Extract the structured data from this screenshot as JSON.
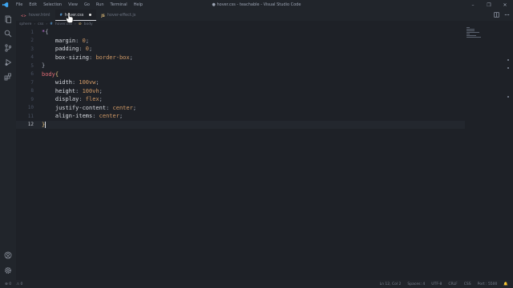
{
  "window": {
    "title": "● hover.css - teachable - Visual Studio Code",
    "menu": [
      "File",
      "Edit",
      "Selection",
      "View",
      "Go",
      "Run",
      "Terminal",
      "Help"
    ],
    "controls": [
      "–",
      "❐",
      "✕"
    ]
  },
  "tabs": [
    {
      "icon": "<>",
      "label": "hover.html",
      "active": false
    },
    {
      "icon": "#",
      "label": "hover.css",
      "active": true,
      "modified": true
    },
    {
      "icon": "JS",
      "label": "hover-effect.js",
      "active": false
    }
  ],
  "breadcrumb": [
    "sphere",
    "css",
    "hover.css",
    "body"
  ],
  "editor": {
    "current_line": 12,
    "lines": [
      {
        "n": "1",
        "parts": [
          {
            "t": "*",
            "c": "sel"
          },
          {
            "t": "{",
            "c": "punc"
          }
        ]
      },
      {
        "n": "2",
        "parts": [
          {
            "t": "    margin",
            "c": "prop"
          },
          {
            "t": ": ",
            "c": "punc"
          },
          {
            "t": "0",
            "c": "val"
          },
          {
            "t": ";",
            "c": "punc"
          }
        ]
      },
      {
        "n": "3",
        "parts": [
          {
            "t": "    padding",
            "c": "prop"
          },
          {
            "t": ": ",
            "c": "punc"
          },
          {
            "t": "0",
            "c": "val"
          },
          {
            "t": ";",
            "c": "punc"
          }
        ]
      },
      {
        "n": "4",
        "parts": [
          {
            "t": "    box-sizing",
            "c": "prop"
          },
          {
            "t": ": ",
            "c": "punc"
          },
          {
            "t": "border-box",
            "c": "val"
          },
          {
            "t": ";",
            "c": "punc"
          }
        ]
      },
      {
        "n": "5",
        "parts": [
          {
            "t": "}",
            "c": "punc"
          }
        ]
      },
      {
        "n": "6",
        "parts": [
          {
            "t": "body",
            "c": "tag"
          },
          {
            "t": "{",
            "c": "kw"
          }
        ]
      },
      {
        "n": "7",
        "parts": [
          {
            "t": "    width",
            "c": "prop"
          },
          {
            "t": ": ",
            "c": "punc"
          },
          {
            "t": "100vw",
            "c": "val"
          },
          {
            "t": ";",
            "c": "punc"
          }
        ]
      },
      {
        "n": "8",
        "parts": [
          {
            "t": "    height",
            "c": "prop"
          },
          {
            "t": ": ",
            "c": "punc"
          },
          {
            "t": "100vh",
            "c": "val"
          },
          {
            "t": ";",
            "c": "punc"
          }
        ]
      },
      {
        "n": "9",
        "parts": [
          {
            "t": "    display",
            "c": "prop"
          },
          {
            "t": ": ",
            "c": "punc"
          },
          {
            "t": "flex",
            "c": "val"
          },
          {
            "t": ";",
            "c": "punc"
          }
        ]
      },
      {
        "n": "10",
        "parts": [
          {
            "t": "    justify-content",
            "c": "prop"
          },
          {
            "t": ": ",
            "c": "punc"
          },
          {
            "t": "center",
            "c": "val"
          },
          {
            "t": ";",
            "c": "punc"
          }
        ]
      },
      {
        "n": "11",
        "parts": [
          {
            "t": "    align-items",
            "c": "prop"
          },
          {
            "t": ": ",
            "c": "punc"
          },
          {
            "t": "center",
            "c": "val"
          },
          {
            "t": ";",
            "c": "punc"
          }
        ]
      },
      {
        "n": "12",
        "parts": [
          {
            "t": "}",
            "c": "kw"
          }
        ]
      }
    ]
  },
  "statusbar": {
    "left": [
      "⊗ 0",
      "⚠ 0"
    ],
    "right": [
      "Ln 12, Col 2",
      "Spaces: 4",
      "UTF-8",
      "CRLF",
      "CSS",
      "Port : 5500",
      "🔔"
    ]
  },
  "colors": {
    "background": "#1e2127",
    "chrome": "#21252b",
    "selector": "#c678dd",
    "tag": "#e06c75",
    "value": "#d19a66",
    "brace": "#e5c07b"
  }
}
